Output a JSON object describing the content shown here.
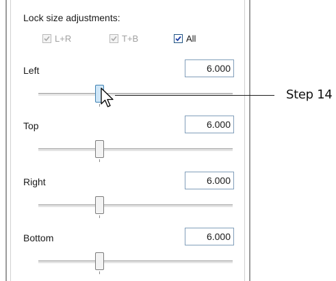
{
  "group_title": "Lock size adjustments:",
  "checkboxes": [
    {
      "label": "L+R",
      "checked": true,
      "enabled": false
    },
    {
      "label": "T+B",
      "checked": true,
      "enabled": false
    },
    {
      "label": "All",
      "checked": true,
      "enabled": true
    }
  ],
  "rows": [
    {
      "label": "Left",
      "value": "6.000"
    },
    {
      "label": "Top",
      "value": "6.000"
    },
    {
      "label": "Right",
      "value": "6.000"
    },
    {
      "label": "Bottom",
      "value": "6.000"
    }
  ],
  "callout": {
    "text": "Step 14"
  },
  "colors": {
    "check_enabled": "#1c5180",
    "check_disabled": "#a0a0a0",
    "thumb_hover": "#cfe6f7"
  },
  "icons": {
    "checkmark": "check-icon",
    "pointer": "mouse-pointer-icon"
  }
}
